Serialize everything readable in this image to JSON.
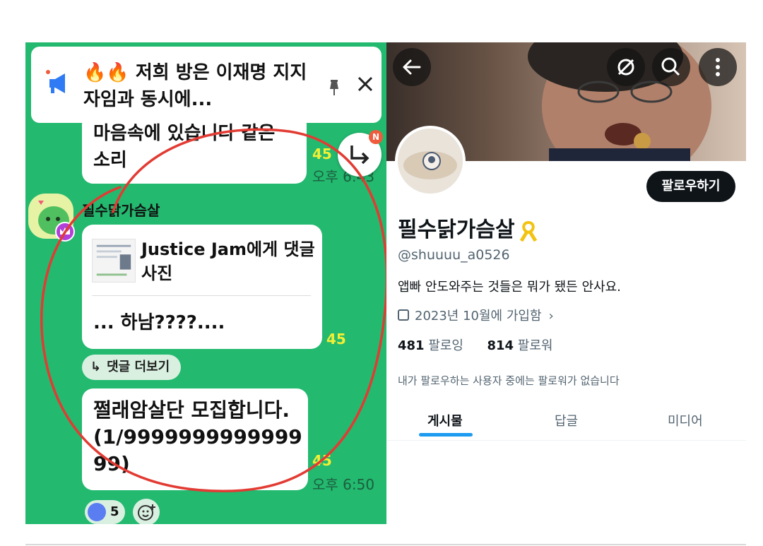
{
  "chat": {
    "notice": {
      "emoji": "🔥🔥",
      "text": "저희 방은 이재명 지지자임과 동시에..."
    },
    "messages": [
      {
        "text": "마음속에 있습니다 같은 소리",
        "unread": "45",
        "time": "오후 6:43"
      },
      {
        "sender": "필수닭가슴살",
        "reply_title": "Justice Jam에게 댓글 사진",
        "text": "... 하남????....",
        "unread": "45"
      },
      {
        "text": "쩔래암살단 모집합니다. (1/999999999999999)",
        "unread": "45",
        "time": "오후 6:50"
      }
    ],
    "more_replies_label": "댓글 더보기",
    "reply_badge": "N",
    "reaction_count": "5",
    "colors": {
      "background": "#23b96f",
      "unread": "#f2ef35",
      "annotation": "#e23b33"
    }
  },
  "profile": {
    "name": "필수닭가슴살",
    "handle": "@shuuuu_a0526",
    "bio": "앱빠 안도와주는 것들은 뭐가 됐든 안사요.",
    "joined": "2023년 10월에 가입함",
    "following_count": "481",
    "following_label": "팔로잉",
    "followers_count": "814",
    "followers_label": "팔로워",
    "no_mutual_followers": "내가 팔로우하는 사용자 중에는 팔로워가 없습니다",
    "follow_button": "팔로우하기",
    "tabs": [
      {
        "label": "게시물"
      },
      {
        "label": "답글"
      },
      {
        "label": "미디어"
      }
    ],
    "colors": {
      "follow_button": "#0f1419",
      "tab_underline": "#1d9bf0"
    }
  }
}
